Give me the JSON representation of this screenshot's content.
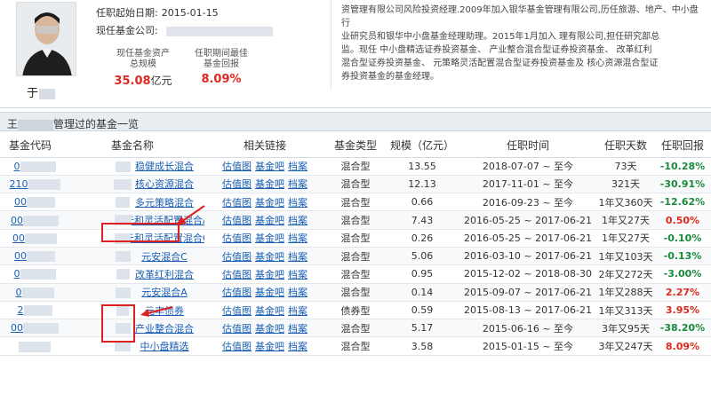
{
  "profile": {
    "name_visible": "于",
    "start_label": "任职起始日期:",
    "start_value": "2015-01-15",
    "company_label": "现任基金公司:",
    "stat_aum_caption_1": "现任基金资产",
    "stat_aum_caption_2": "总规模",
    "stat_aum_value": "35.08",
    "stat_aum_unit": "亿元",
    "stat_best_caption_1": "任职期间最佳",
    "stat_best_caption_2": "基金回报",
    "stat_best_value": "8.09%",
    "bio_lines": [
      "资管理有限公司风险投资经理.2009年加入银华基金管理有限公司,历任旅游、地产、中小盘行",
      "业研究员和银华中小盘基金经理助理。2015年1月加入                       理有限公司,担任研究部总",
      "监。现任        中小盘精选证券投资基金、       产业整合混合型证券投资基金、         改革红利",
      "混合型证券投资基金、          元策略灵活配置混合型证券投资基金及         核心资源混合型证",
      "券投资基金的基金经理。"
    ]
  },
  "section": {
    "title_prefix": "王",
    "title_suffix": "管理过的基金一览"
  },
  "table": {
    "headers": [
      "基金代码",
      "基金名称",
      "相关链接",
      "基金类型",
      "规模（亿元）",
      "任职时间",
      "任职天数",
      "任职回报"
    ],
    "link_labels": [
      "估值图",
      "基金吧",
      "档案"
    ],
    "rows": [
      {
        "code": "0",
        "name": "稳健成长混合",
        "type": "混合型",
        "size": "13.55",
        "period": "2018-07-07 ~ 至今",
        "days": "73天",
        "ret": "-10.28%"
      },
      {
        "code": "210",
        "name": "核心资源混合",
        "type": "混合型",
        "size": "12.13",
        "period": "2017-11-01 ~ 至今",
        "days": "321天",
        "ret": "-30.91%"
      },
      {
        "code": "00",
        "name": "多元策略混合",
        "type": "混合型",
        "size": "0.66",
        "period": "2016-09-23 ~ 至今",
        "days": "1年又360天",
        "ret": "-12.62%"
      },
      {
        "code": "00",
        "name": "元和灵活配置混合A",
        "type": "混合型",
        "size": "7.43",
        "period": "2016-05-25 ~ 2017-06-21",
        "days": "1年又27天",
        "ret": "0.50%"
      },
      {
        "code": "00",
        "name": "元和灵活配置混合C",
        "type": "混合型",
        "size": "0.26",
        "period": "2016-05-25 ~ 2017-06-21",
        "days": "1年又27天",
        "ret": "-0.10%"
      },
      {
        "code": "00",
        "name": "元安混合C",
        "type": "混合型",
        "size": "5.06",
        "period": "2016-03-10 ~ 2017-06-21",
        "days": "1年又103天",
        "ret": "-0.13%"
      },
      {
        "code": "0",
        "name": "改革红利混合",
        "type": "混合型",
        "size": "0.95",
        "period": "2015-12-02 ~ 2018-08-30",
        "days": "2年又272天",
        "ret": "-3.00%"
      },
      {
        "code": "0",
        "name": "元安混合A",
        "type": "混合型",
        "size": "0.14",
        "period": "2015-09-07 ~ 2017-06-21",
        "days": "1年又288天",
        "ret": "2.27%"
      },
      {
        "code": "2",
        "name": "元丰债券",
        "type": "债券型",
        "size": "0.59",
        "period": "2015-08-13 ~ 2017-06-21",
        "days": "1年又313天",
        "ret": "3.95%"
      },
      {
        "code": "00",
        "name": "产业整合混合",
        "type": "混合型",
        "size": "5.17",
        "period": "2015-06-16 ~ 至今",
        "days": "3年又95天",
        "ret": "-38.20%"
      },
      {
        "code": "",
        "name": "中小盘精选",
        "type": "混合型",
        "size": "3.58",
        "period": "2015-01-15 ~ 至今",
        "days": "3年又247天",
        "ret": "8.09%"
      }
    ]
  },
  "colors": {
    "link": "#1a5fb4",
    "positive": "#e0281f",
    "negative": "#1a8a3a",
    "annotation": "#e02020"
  }
}
